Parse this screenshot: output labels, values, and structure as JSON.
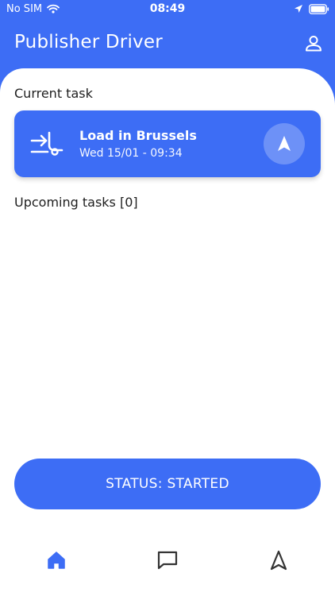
{
  "status_bar": {
    "carrier": "No SIM",
    "time": "08:49"
  },
  "header": {
    "title": "Publisher Driver"
  },
  "current_task": {
    "section_title": "Current task",
    "name": "Load in Brussels",
    "datetime": "Wed 15/01 - 09:34"
  },
  "upcoming": {
    "section_title": "Upcoming tasks [0]"
  },
  "status_button": {
    "label": "STATUS: STARTED"
  },
  "tabs": {
    "active": "home",
    "active_color": "#3d6df5",
    "inactive_color": "#333333"
  },
  "colors": {
    "primary": "#3d6df5",
    "background": "#ffffff"
  }
}
